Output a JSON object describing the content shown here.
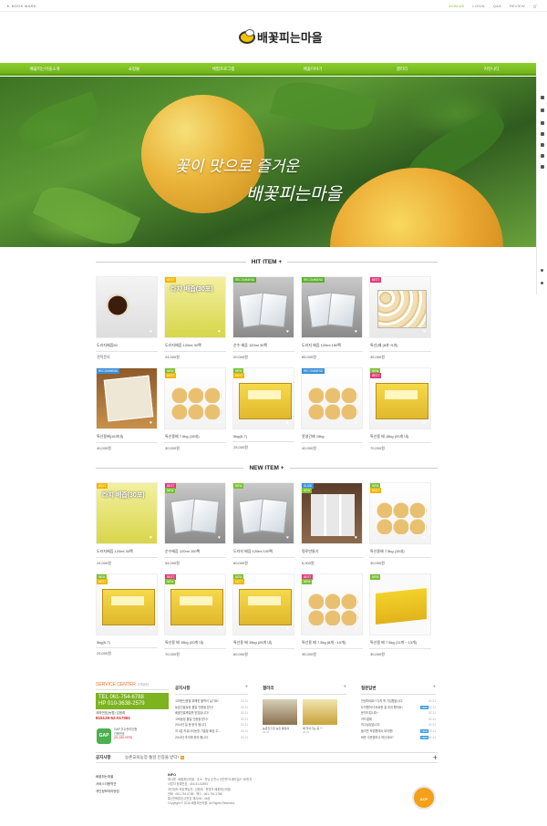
{
  "topbar": {
    "bookmark": "BOOK MARK",
    "links": [
      "JOIN US",
      "LOGIN",
      "Q&A",
      "REVIEW"
    ],
    "cart_icon": "cart-icon"
  },
  "logo": {
    "text": "배꽃피는마을"
  },
  "nav": [
    "배꽃피는마을소개",
    "쇼핑몰",
    "체험프로그램",
    "배꽃이야기",
    "갤러리",
    "커뮤니티"
  ],
  "banner": {
    "line1": "꽃이 맛으로 즐거운",
    "line2": "배꽃피는마을"
  },
  "sections": {
    "hit": "HIT ITEM +",
    "new": "NEW ITEM +"
  },
  "hit_items": [
    {
      "name": "도라지배즙50",
      "price": "견적문의",
      "style": "th-tea",
      "badges": []
    },
    {
      "name": "도라지배즙 120ml 30팩",
      "price": "24,000원",
      "style": "th-juice",
      "label": "라지 배즙(30포)",
      "badges": [
        {
          "t": "BEST",
          "c": "#f2b600"
        }
      ]
    },
    {
      "name": "순수 배즙 120ml 30팩",
      "price": "20,000원",
      "style": "th-pack",
      "badges": [
        {
          "t": "RECOMMEND",
          "c": "#5ab02e"
        }
      ]
    },
    {
      "name": "도라지 배즙 120ml 150팩",
      "price": "85,000원",
      "style": "th-pack",
      "badges": [
        {
          "t": "RECOMMEND",
          "c": "#5ab02e"
        }
      ]
    },
    {
      "name": "특선(배 (8과~9과)",
      "price": "45,000원",
      "style": "th-box",
      "badges": [
        {
          "t": "BEST",
          "c": "#e03c7b"
        }
      ]
    },
    {
      "name": "특선용배(16과내)",
      "price": "40,000원",
      "style": "th-gift",
      "badges": [
        {
          "t": "RECOMMEND",
          "c": "#3a8fd6"
        }
      ]
    },
    {
      "name": "특선용배 7.5kg (15내)",
      "price": "30,000원",
      "style": "th-pears",
      "badges": [
        {
          "t": "NEW",
          "c": "#7cc035"
        },
        {
          "t": "BEST",
          "c": "#f2b600"
        }
      ]
    },
    {
      "name": "5kg(5-7)",
      "price": "25,000원",
      "style": "th-yellow",
      "badges": [
        {
          "t": "NEW",
          "c": "#7cc035"
        },
        {
          "t": "BEST",
          "c": "#f2b600"
        }
      ]
    },
    {
      "name": "못생긴배 15kg",
      "price": "40,000원",
      "style": "th-pears",
      "badges": [
        {
          "t": "RECOMMEND",
          "c": "#3a8fd6"
        }
      ]
    },
    {
      "name": "특선용 배 15kg (20개 내)",
      "price": "70,000원",
      "style": "th-yellow",
      "badges": [
        {
          "t": "NEW",
          "c": "#7cc035"
        },
        {
          "t": "BEST",
          "c": "#e03c7b"
        }
      ]
    }
  ],
  "new_items": [
    {
      "name": "도라지배즙 120ml 30팩",
      "price": "24,000원",
      "style": "th-juice",
      "label": "라지 배즙(30포)",
      "badges": [
        {
          "t": "BEST",
          "c": "#f2b600"
        }
      ]
    },
    {
      "name": "순수배즙 120ml 100팩",
      "price": "54,000원",
      "style": "th-pack",
      "badges": [
        {
          "t": "BEST",
          "c": "#e03c7b"
        },
        {
          "t": "NEW",
          "c": "#7cc035"
        }
      ]
    },
    {
      "name": "도라지 배즙 120ml 100팩",
      "price": "60,000원",
      "style": "th-pack",
      "badges": [
        {
          "t": "NEW",
          "c": "#7cc035"
        }
      ]
    },
    {
      "name": "명로만들기",
      "price": "5,000원",
      "style": "th-jug",
      "badges": [
        {
          "t": "DLMS",
          "c": "#3a8fd6"
        },
        {
          "t": "NEW",
          "c": "#7cc035"
        }
      ]
    },
    {
      "name": "특선용배 7.5kg (15내)",
      "price": "30,000원",
      "style": "th-pears",
      "badges": [
        {
          "t": "NEW",
          "c": "#7cc035"
        },
        {
          "t": "BEST",
          "c": "#f2b600"
        }
      ]
    },
    {
      "name": "5kg(5-7)",
      "price": "25,000원",
      "style": "th-yellow",
      "badges": [
        {
          "t": "NEW",
          "c": "#7cc035"
        },
        {
          "t": "BEST",
          "c": "#f2b600"
        }
      ]
    },
    {
      "name": "특선용 배 15kg (20개 내)",
      "price": "70,000원",
      "style": "th-yellow",
      "badges": [
        {
          "t": "BEST",
          "c": "#e03c7b"
        },
        {
          "t": "NEW",
          "c": "#7cc035"
        }
      ]
    },
    {
      "name": "특선용 배 15kg (25개 내)",
      "price": "60,000원",
      "style": "th-yellow",
      "badges": [
        {
          "t": "NEW",
          "c": "#7cc035"
        },
        {
          "t": "BEST",
          "c": "#f2b600"
        }
      ]
    },
    {
      "name": "특선용 배 7.5kg (8개 ~10개)",
      "price": "35,000원",
      "style": "th-pears",
      "badges": [
        {
          "t": "BEST",
          "c": "#e03c7b"
        },
        {
          "t": "NEW",
          "c": "#7cc035"
        }
      ]
    },
    {
      "name": "특선용 배 7.5kg (11개 ~ 13개)",
      "price": "30,000원",
      "style": "th-yellowbox",
      "badges": [
        {
          "t": "NEW",
          "c": "#7cc035"
        }
      ]
    }
  ],
  "service": {
    "title": "SERVICE CENTER",
    "subtitle": "고객센터",
    "tel": "TEL 061-754-6788",
    "hp": "HP 010-3638-2579",
    "bank": "계좌번호(농협) 김용희",
    "account": "815129-52-017081",
    "gap_badge": "GAP",
    "gap_line1": "GAP 우수관리인증",
    "gap_line2": "인증번호",
    "gap_line3": "(01-183-0075)"
  },
  "boards": {
    "notice": {
      "title": "공지사항",
      "items": [
        {
          "t": "고마운신용을 위해한 물학이 날기요!",
          "d": "02.21"
        },
        {
          "t": "농촌진흥농장 통일 인증을 받다!",
          "d": "02.21"
        },
        {
          "t": "배꽃진흥축일를 받았습니다!",
          "d": "02.21"
        },
        {
          "t": "고희농장 통일 인증을 받다!",
          "d": "02.21"
        },
        {
          "t": "2014년 늘 봄 한국 됩니다.",
          "d": "02.21"
        },
        {
          "t": "저 3분 커뮤니티농장 기흥할 화된 주...",
          "d": "02.21"
        },
        {
          "t": "2013년 추석에 한국 합니다.",
          "d": "02.21"
        }
      ]
    },
    "gallery": {
      "title": "갤러리",
      "items": [
        {
          "t": "농촌진흥청 농장 통일의 ...",
          "d": "02.21"
        },
        {
          "t": "배 익어가는 중 ^^",
          "d": "02.21"
        }
      ]
    },
    "qna": {
      "title": "질문답변",
      "items": [
        {
          "t": "안녕하세요? 다치 작 가입했습니다.",
          "d": "02.21",
          "n": false
        },
        {
          "t": "도착했어서 바로왔 잘 되어 했어요!",
          "d": "02.21",
          "n": true
        },
        {
          "t": "문의드립니다~",
          "d": "02.21",
          "n": false
        },
        {
          "t": "카드결제",
          "d": "02.21",
          "n": false
        },
        {
          "t": "하고싶었습니다.",
          "d": "02.21",
          "n": false
        },
        {
          "t": "돌이웃 작업원에서 되어봤!",
          "d": "02.21",
          "n": true
        },
        {
          "t": "바를 주문할려고 하는데요?",
          "d": "02.21",
          "n": true
        }
      ]
    }
  },
  "notice_bar": {
    "title": "공지사항",
    "message": "농촌교육농장 통일 인증을 받다!",
    "new": "N"
  },
  "footer": {
    "links": [
      "배꽃피는마을",
      "서비스이용약관",
      "개인정보처리방침"
    ],
    "info_title": "INFO",
    "info_lines": [
      "회사명 : 배꽃피는마을 · 주소 : 전남 순천시 낙안면 아세리길27-50번지",
      "사업자 등록번호 : 416-91-62893",
      "개인정보 보호책임자 : 김용희 · 운영자 배꽃피는마을",
      "전화 : 061-754-6788 · 팩스 : 061-751-1788",
      "통신판매업신고번호 제2006 - 46호",
      "Copyright © 2016 배꽃피는마을. All Rights Reserved."
    ],
    "seal": "ACP"
  }
}
